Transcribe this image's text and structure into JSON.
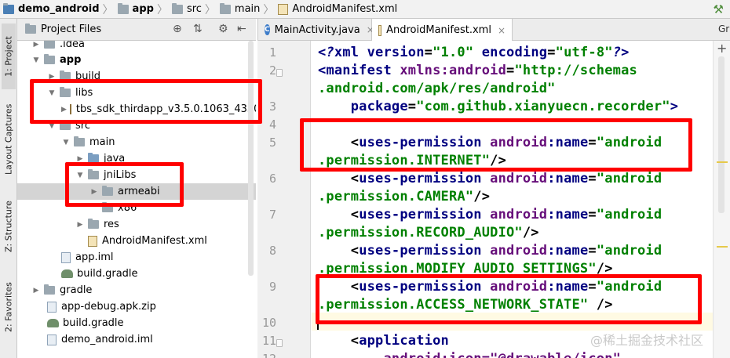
{
  "breadcrumb": {
    "items": [
      {
        "label": "demo_android",
        "icon": "project-folder-icon"
      },
      {
        "label": "app",
        "icon": "folder-icon"
      },
      {
        "label": "src",
        "icon": "folder-icon"
      },
      {
        "label": "main",
        "icon": "folder-icon"
      },
      {
        "label": "AndroidManifest.xml",
        "icon": "xml-file-icon"
      }
    ],
    "build_icon": "hammer-icon"
  },
  "toolstrip": {
    "tabs": [
      "1: Project",
      "Layout Captures",
      "Z: Structure",
      "2: Favorites"
    ]
  },
  "project_panel": {
    "title": "Project Files",
    "rows": [
      {
        "label": ".idea",
        "arrow": "▶"
      },
      {
        "label": "app",
        "arrow": "▼"
      },
      {
        "label": "build",
        "arrow": "▶"
      },
      {
        "label": "libs",
        "arrow": "▼"
      },
      {
        "label": "tbs_sdk_thirdapp_v3.5.0.1063_43500_",
        "arrow": "▶"
      },
      {
        "label": "src",
        "arrow": "▼"
      },
      {
        "label": "main",
        "arrow": "▼"
      },
      {
        "label": "java",
        "arrow": "▶"
      },
      {
        "label": "jniLibs",
        "arrow": "▼"
      },
      {
        "label": "armeabi",
        "arrow": "▶"
      },
      {
        "label": "x86",
        "arrow": ""
      },
      {
        "label": "res",
        "arrow": "▶"
      },
      {
        "label": "AndroidManifest.xml",
        "arrow": ""
      },
      {
        "label": "app.iml",
        "arrow": ""
      },
      {
        "label": "build.gradle",
        "arrow": ""
      },
      {
        "label": "gradle",
        "arrow": "▶"
      },
      {
        "label": "app-debug.apk.zip",
        "arrow": ""
      },
      {
        "label": "build.gradle",
        "arrow": ""
      },
      {
        "label": "demo_android.iml",
        "arrow": ""
      }
    ]
  },
  "editor_tabs": {
    "tabs": [
      "MainActivity.java",
      "AndroidManifest.xml"
    ],
    "close": "×",
    "extra": "Gr"
  },
  "editor": {
    "line_numbers": [
      "1",
      "2",
      "3",
      "4",
      "5",
      "6",
      "7",
      "8",
      "9",
      "10",
      "11",
      "12"
    ],
    "lines": {
      "l1": {
        "open": "<?",
        "tag": "xml",
        "a1": "version",
        "v1": "\"1.0\"",
        "a2": "encoding",
        "v2": "\"utf-8\"",
        "close": "?>"
      },
      "l2a": {
        "open": "<",
        "tag": "manifest",
        "ns": "xmlns:",
        "attr": "android",
        "eq": "=",
        "val": "\"http://schemas"
      },
      "l2b": {
        "val": ".android.com/apk/res/android\""
      },
      "l3": {
        "attr": "package",
        "eq": "=",
        "val": "\"com.github.xianyuecn.recorder\"",
        "close": ">"
      },
      "perm_tag": "uses-permission",
      "perm_ns": "android",
      "perm_attr": ":name",
      "perm_val_start": "\"android",
      "l5b": ".permission.INTERNET\"",
      "l6b": ".permission.CAMERA\"",
      "l7b": ".permission.RECORD_AUDIO\"",
      "l8b": ".permission.MODIFY_AUDIO_SETTINGS\"",
      "l9b": ".permission.ACCESS_NETWORK_STATE\"",
      "l11": "application",
      "l12": "android:icon=\"@drawable/icon\""
    }
  },
  "right_gutter": {
    "plus": "+"
  },
  "watermark": "@稀土掘金技术社区",
  "colors": {
    "highlight": "#ff0000",
    "tag": "#000080",
    "attribute": "#660e7a",
    "value": "#008000"
  }
}
